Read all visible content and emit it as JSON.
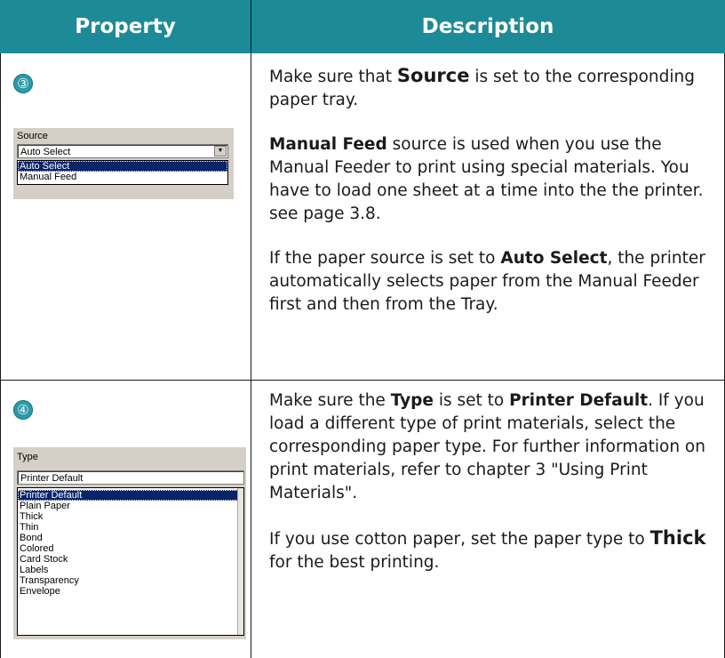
{
  "header": {
    "property": "Property",
    "description": "Description"
  },
  "rows": [
    {
      "marker": "③",
      "widget": {
        "label": "Source",
        "selected": "Auto Select",
        "options": [
          "Auto Select",
          "Manual Feed"
        ]
      },
      "paragraphs": [
        {
          "a": "Make sure that ",
          "b": "Source",
          "c": " is set to the corresponding paper tray."
        },
        {
          "a": "",
          "b": "Manual Feed",
          "c": " source is used when you use the Manual Feeder to print using special materials. You have to load one sheet at a time into the the printer. see page 3.8."
        },
        {
          "a": "If the paper source is set to ",
          "b": "Auto Select",
          "c": ", the printer automatically selects paper from the Manual Feeder first and then from the Tray."
        }
      ]
    },
    {
      "marker": "④",
      "widget": {
        "label": "Type",
        "selected": "Printer Default",
        "options": [
          "Printer Default",
          "Plain Paper",
          "Thick",
          "Thin",
          "Bond",
          "Colored",
          "Card Stock",
          "Labels",
          "Transparency",
          "Envelope"
        ]
      },
      "paragraphs": [
        {
          "a": "Make sure the ",
          "b": "Type",
          "c": " is set to ",
          "d": "Printer Default",
          "e": ". If you load a different type of print materials, select the corresponding paper type. For further information on print materials, refer to chapter 3 \"Using Print Materials\"."
        },
        {
          "a": "If you use cotton paper, set the paper type to ",
          "b": "Thick",
          "c": " for the best printing."
        }
      ]
    }
  ]
}
